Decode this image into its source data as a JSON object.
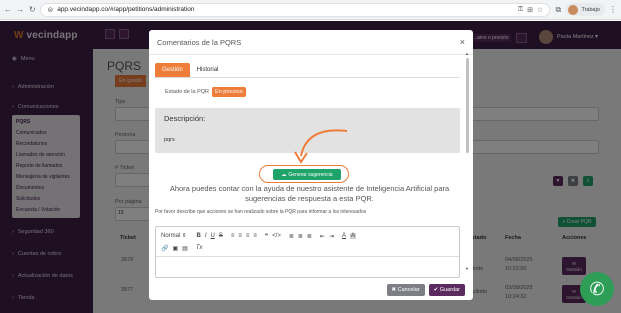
{
  "browser": {
    "url": "app.vecindapp.co/#/app/petitions/administration",
    "profile_label": "Trabajo"
  },
  "sidebar": {
    "brand": "vecindapp",
    "items": [
      {
        "label": "Menu"
      },
      {
        "label": "Administración"
      },
      {
        "label": "Comunicaciones"
      }
    ],
    "submenu": [
      {
        "label": "PQRS"
      },
      {
        "label": "Comunicados"
      },
      {
        "label": "Recordatorios"
      },
      {
        "label": "Llamados de atención"
      },
      {
        "label": "Reporte de llamados"
      },
      {
        "label": "Mensajería de vigilantes"
      },
      {
        "label": "Documentos"
      },
      {
        "label": "Solicitudes"
      },
      {
        "label": "Encuesta / Votación"
      }
    ],
    "lower_items": [
      {
        "label": "Seguridad 360"
      },
      {
        "label": "Cuentas de cobro"
      },
      {
        "label": "Actualización de datos"
      },
      {
        "label": "Tienda"
      }
    ]
  },
  "topbar": {
    "user_name": "Paola Martinez",
    "dropdown_arrow": "▾",
    "truncated_button": "...aine o presión"
  },
  "background_page": {
    "title": "PQRS",
    "tab_partial": "En gestió",
    "labels": {
      "tipo": "Tipo",
      "persona": "Persona",
      "ticket": "# Ticket",
      "por_pagina": "Por página",
      "por_pagina_value": "10"
    },
    "crear_button": "+ Crear PQR",
    "table": {
      "headers": [
        "Ticket",
        "Estado",
        "Fecha",
        "Acciones"
      ],
      "rows": [
        {
          "ticket": "3979",
          "estado": "...ente",
          "fecha": "04/08/2025",
          "hora": "10:22:50",
          "accion": "Gestión"
        },
        {
          "ticket": "3977",
          "estado": "...cibido",
          "fecha": "03/08/2025",
          "hora": "10:24:32",
          "accion": "Gestión"
        }
      ]
    }
  },
  "modal": {
    "title": "Comentarios de la PQRS",
    "close": "×",
    "tabs": [
      {
        "label": "Gestión",
        "active": true
      },
      {
        "label": "Historial",
        "active": false
      }
    ],
    "estado_label": "Estado de la PQR",
    "estado_value": "En proceso",
    "description_title": "Descripción:",
    "description_value": "pqrs",
    "generate_button": "Generar sugerencia",
    "ai_text": "Ahora puedes contar con la ayuda de nuestro asistente de Inteligencia Artificial para sugerencias de respuesta a esta PQR.",
    "help_text": "Por favor describe que acciones se han realizado sobre la PQR para informar a los interesados",
    "editor": {
      "format_select": "Normal",
      "tools_row1": [
        "B",
        "I",
        "U",
        "S",
        "≡",
        "≡",
        "≡",
        "≡",
        "❞",
        "</>",
        "≣",
        "≣",
        "≣",
        "⇤",
        "⇥",
        "A",
        "A"
      ],
      "tools_row2": [
        "🔗",
        "▣",
        "▤",
        "Tx"
      ]
    },
    "cancel_button": "✖ Cancelar",
    "save_button": "✔ Guardar"
  },
  "colors": {
    "brand_purple": "#3d1f45",
    "accent_orange": "#ee7d3a",
    "success_green": "#1ea36b",
    "save_purple": "#5b2a5f",
    "cancel_gray": "#7d7f84"
  }
}
